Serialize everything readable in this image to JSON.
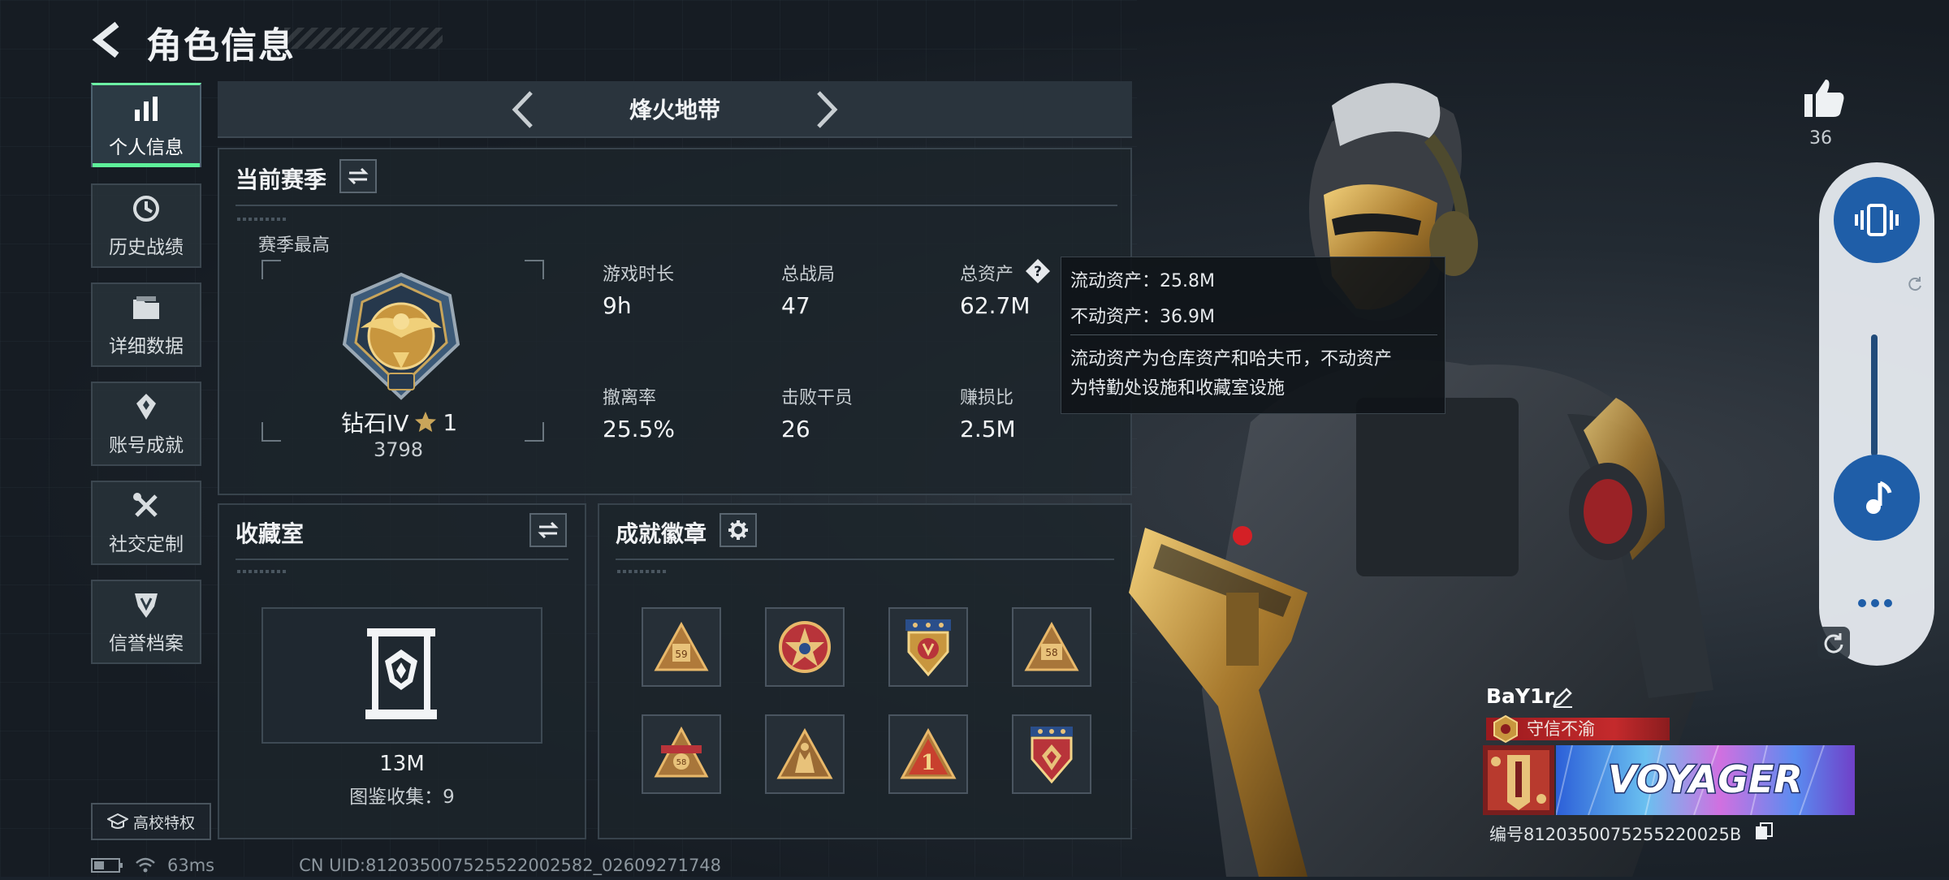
{
  "header": {
    "title": "角色信息"
  },
  "nav": [
    {
      "label": "个人信息",
      "icon": "bar-chart-icon",
      "active": true
    },
    {
      "label": "历史战绩",
      "icon": "history-icon"
    },
    {
      "label": "详细数据",
      "icon": "folder-icon"
    },
    {
      "label": "账号成就",
      "icon": "achievement-icon"
    },
    {
      "label": "社交定制",
      "icon": "tools-icon"
    },
    {
      "label": "信誉档案",
      "icon": "shield-icon"
    }
  ],
  "campus_button": "高校特权",
  "mode": {
    "name": "烽火地带"
  },
  "season": {
    "title": "当前赛季",
    "best_label": "赛季最高",
    "rank": "钻石IV",
    "stars": "1",
    "score": "3798",
    "stats": [
      {
        "label": "游戏时长",
        "value": "9h"
      },
      {
        "label": "总战局",
        "value": "47"
      },
      {
        "label": "总资产",
        "value": "62.7M"
      },
      {
        "label": "撤离率",
        "value": "25.5%"
      },
      {
        "label": "击败干员",
        "value": "26"
      },
      {
        "label": "赚损比",
        "value": "2.5M"
      }
    ]
  },
  "tooltip": {
    "line1": "流动资产：25.8M",
    "line2": "不动资产：36.9M",
    "desc1": "流动资产为仓库资产和哈夫币，不动资产",
    "desc2": "为特勤处设施和收藏室设施"
  },
  "collection": {
    "title": "收藏室",
    "value": "13M",
    "catalog": "图鉴收集：9"
  },
  "badges": {
    "title": "成就徽章",
    "items": [
      "59",
      "",
      "",
      "58",
      "58",
      "",
      "1",
      ""
    ]
  },
  "player": {
    "name": "BaY1r",
    "honor": "守信不渝",
    "banner_text": "VOYAGER",
    "id": "编号8120350075255220025B"
  },
  "likes": {
    "count": "36"
  },
  "status": {
    "ping": "63ms",
    "uid": "CN UID:812035007525522002582_02609271748"
  },
  "colors": {
    "accent_green": "#5ef09a",
    "pill_blue": "#1f5ea8",
    "honor_red": "#c42a2c"
  }
}
